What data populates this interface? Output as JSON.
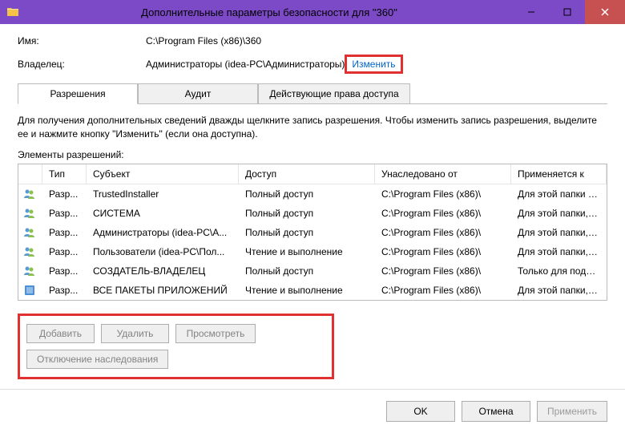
{
  "titlebar": {
    "title": "Дополнительные параметры безопасности  для \"360\""
  },
  "fields": {
    "name_label": "Имя:",
    "name_value": "C:\\Program Files (x86)\\360",
    "owner_label": "Владелец:",
    "owner_value": "Администраторы (idea-PC\\Администраторы)",
    "change_link": "Изменить"
  },
  "tabs": {
    "permissions": "Разрешения",
    "audit": "Аудит",
    "effective": "Действующие права доступа"
  },
  "help_text": "Для получения дополнительных сведений дважды щелкните запись разрешения. Чтобы изменить запись разрешения, выделите ее и нажмите кнопку \"Изменить\" (если она доступна).",
  "section_label": "Элементы разрешений:",
  "columns": {
    "type": "Тип",
    "subject": "Субъект",
    "access": "Доступ",
    "inherited": "Унаследовано от",
    "applies": "Применяется к"
  },
  "rows": [
    {
      "icon": "users",
      "type": "Разр...",
      "subject": "TrustedInstaller",
      "access": "Полный доступ",
      "inherited": "C:\\Program Files (x86)\\",
      "applies": "Для этой папки и ее подпапок"
    },
    {
      "icon": "users",
      "type": "Разр...",
      "subject": "СИСТЕМА",
      "access": "Полный доступ",
      "inherited": "C:\\Program Files (x86)\\",
      "applies": "Для этой папки, ее подпапок ..."
    },
    {
      "icon": "users",
      "type": "Разр...",
      "subject": "Администраторы (idea-PC\\А...",
      "access": "Полный доступ",
      "inherited": "C:\\Program Files (x86)\\",
      "applies": "Для этой папки, ее подпапок ..."
    },
    {
      "icon": "users",
      "type": "Разр...",
      "subject": "Пользователи (idea-PC\\Пол...",
      "access": "Чтение и выполнение",
      "inherited": "C:\\Program Files (x86)\\",
      "applies": "Для этой папки, ее подпапок ..."
    },
    {
      "icon": "users",
      "type": "Разр...",
      "subject": "СОЗДАТЕЛЬ-ВЛАДЕЛЕЦ",
      "access": "Полный доступ",
      "inherited": "C:\\Program Files (x86)\\",
      "applies": "Только для подпапок и файл..."
    },
    {
      "icon": "package",
      "type": "Разр...",
      "subject": "ВСЕ ПАКЕТЫ ПРИЛОЖЕНИЙ",
      "access": "Чтение и выполнение",
      "inherited": "C:\\Program Files (x86)\\",
      "applies": "Для этой папки, ее подпапок ..."
    }
  ],
  "actions": {
    "add": "Добавить",
    "remove": "Удалить",
    "view": "Просмотреть",
    "disable_inh": "Отключение наследования"
  },
  "footer": {
    "ok": "OK",
    "cancel": "Отмена",
    "apply": "Применить"
  }
}
